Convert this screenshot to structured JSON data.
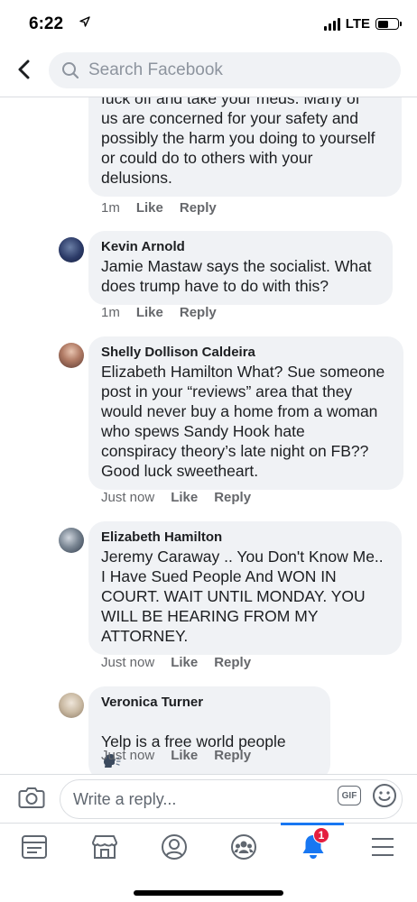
{
  "status_bar": {
    "time": "6:22",
    "network": "LTE",
    "battery_level": 0.55
  },
  "header": {
    "back_icon": "chevron-left-icon",
    "search_placeholder": "Search Facebook"
  },
  "comments": [
    {
      "name": "",
      "text": "fuck off and take your meds.  Many of\nus are concerned for your safety and\npossibly the harm you doing to yourself\nor could do to others with your\ndelusions.",
      "time": "1m",
      "like": "Like",
      "reply": "Reply"
    },
    {
      "name": "Kevin Arnold",
      "text": "Jamie Mastaw says the socialist. What\ndoes trump have to do with this?",
      "time": "1m",
      "like": "Like",
      "reply": "Reply"
    },
    {
      "name": "Shelly Dollison Caldeira",
      "text": "Elizabeth Hamilton What? Sue someone\npost in your “reviews” area that they\nwould never buy a home from a woman\nwho spews Sandy Hook hate\nconspiracy theory’s late night on FB??\nGood luck sweetheart.",
      "time": "Just now",
      "like": "Like",
      "reply": "Reply"
    },
    {
      "name": "Elizabeth Hamilton",
      "text": "Jeremy Caraway .. You Don't Know Me..\nI Have Sued People And WON IN\nCOURT.  WAIT UNTIL MONDAY. YOU\nWILL BE HEARING FROM MY\nATTORNEY.",
      "time": "Just now",
      "like": "Like",
      "reply": "Reply"
    },
    {
      "name": "Veronica Turner",
      "text": "Yelp is a free world people",
      "time": "Just now",
      "like": "Like",
      "reply": "Reply",
      "emoji_icon": "speaking-head-icon"
    }
  ],
  "reply_bar": {
    "placeholder": "Write a reply...",
    "gif_label": "GIF",
    "camera_icon": "camera-icon",
    "emoji_icon": "smiley-icon"
  },
  "tab_bar": {
    "tabs": [
      "news-feed-icon",
      "marketplace-icon",
      "profile-icon",
      "groups-icon",
      "notifications-icon",
      "menu-icon"
    ],
    "notification_count": "1",
    "accent_color": "#1877f2",
    "badge_color": "#e41e3f"
  }
}
